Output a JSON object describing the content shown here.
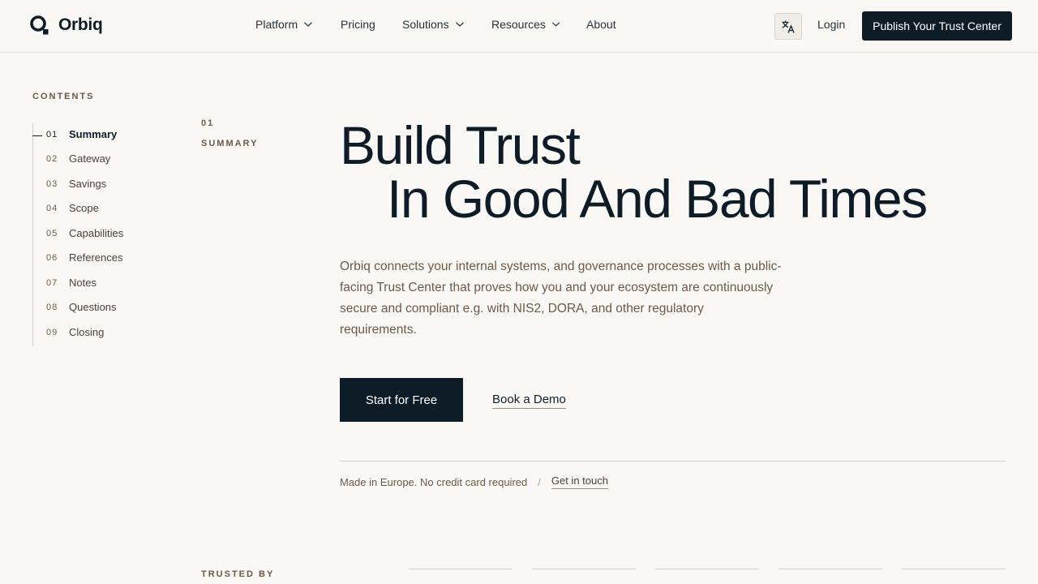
{
  "brand": {
    "name": "Orbiq",
    "accent": "#0e1c27"
  },
  "nav": {
    "items": [
      {
        "label": "Platform",
        "dropdown": true
      },
      {
        "label": "Pricing",
        "dropdown": false
      },
      {
        "label": "Solutions",
        "dropdown": true
      },
      {
        "label": "Resources",
        "dropdown": true
      },
      {
        "label": "About",
        "dropdown": false
      }
    ],
    "translate_icon": "translate-icon",
    "login_label": "Login",
    "publish_label": "Publish Your Trust Center"
  },
  "contents": {
    "title": "CONTENTS",
    "items": [
      {
        "num": "01",
        "label": "Summary",
        "active": true
      },
      {
        "num": "02",
        "label": "Gateway"
      },
      {
        "num": "03",
        "label": "Savings"
      },
      {
        "num": "04",
        "label": "Scope"
      },
      {
        "num": "05",
        "label": "Capabilities"
      },
      {
        "num": "06",
        "label": "References"
      },
      {
        "num": "07",
        "label": "Notes"
      },
      {
        "num": "08",
        "label": "Questions"
      },
      {
        "num": "09",
        "label": "Closing"
      }
    ]
  },
  "section": {
    "num": "01",
    "name": "SUMMARY"
  },
  "hero": {
    "line1": "Build Trust",
    "line2": "In Good And Bad Times",
    "description": "Orbiq connects your internal systems, and governance processes with a public-facing Trust Center that proves how you and your ecosystem are continuously secure and compliant e.g. with NIS2, DORA, and other regulatory requirements.",
    "primary_cta": "Start for Free",
    "secondary_cta": "Book a Demo",
    "footnote": "Made in Europe. No credit card required",
    "separator": "/",
    "contact_link": "Get in touch"
  },
  "trusted": {
    "title": "TRUSTED BY"
  }
}
